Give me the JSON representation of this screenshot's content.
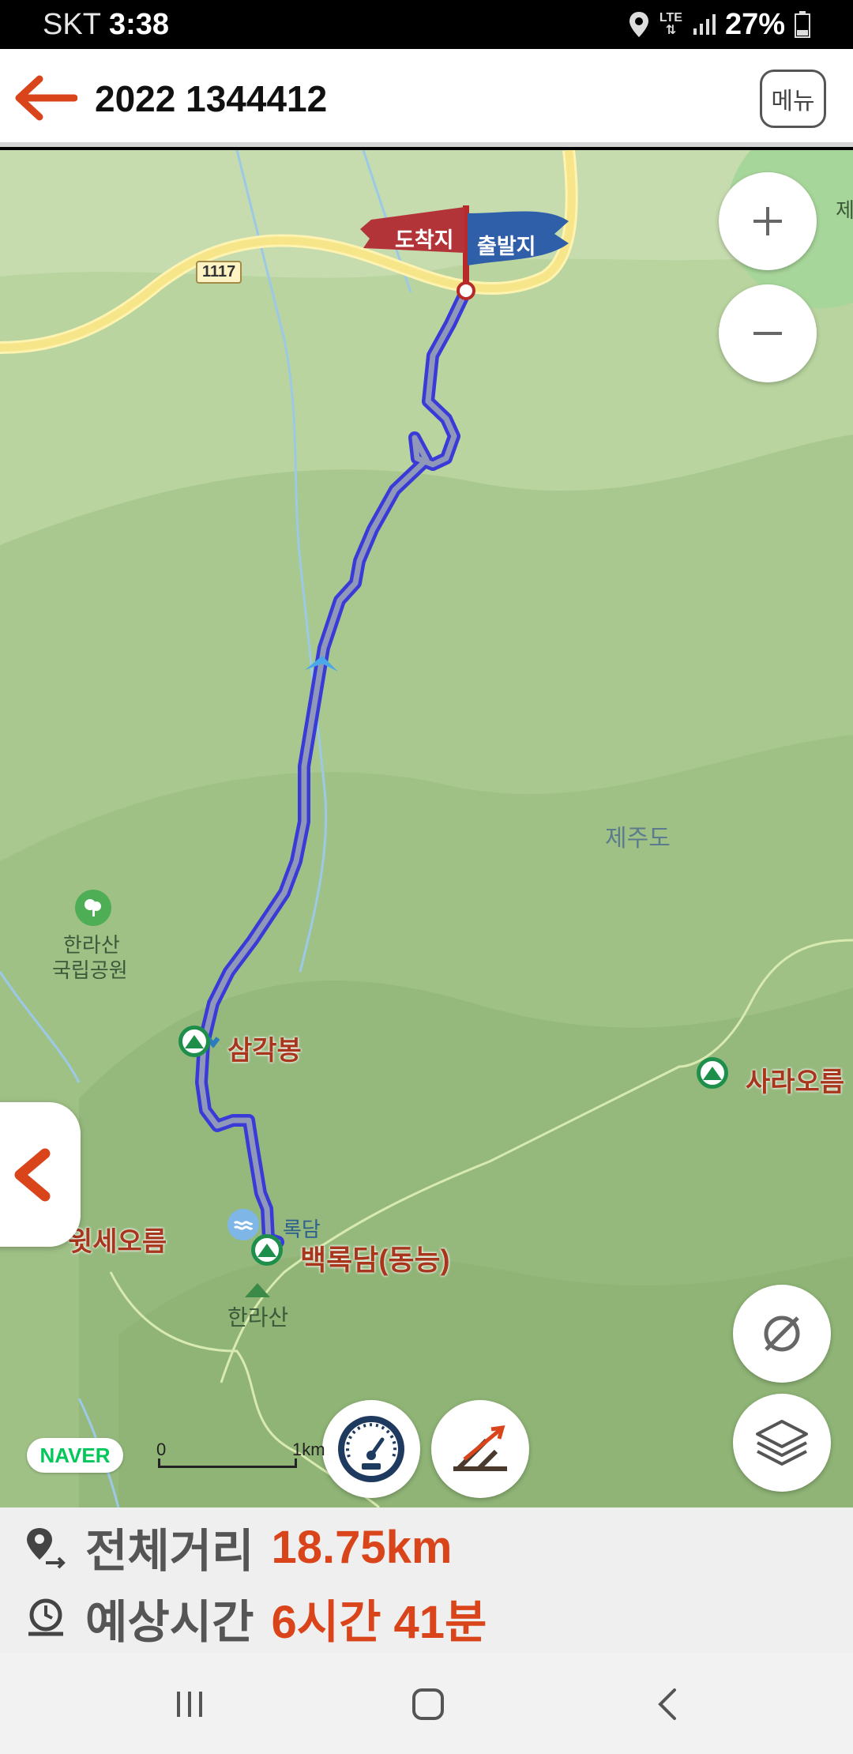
{
  "status": {
    "carrier": "SKT",
    "time": "3:38",
    "network": "LTE",
    "battery": "27%"
  },
  "header": {
    "title": "2022 1344412",
    "menu_label": "메뉴",
    "back_icon": "arrow-left-icon"
  },
  "map": {
    "flags": {
      "arrival": "도착지",
      "departure": "출발지"
    },
    "road_number": "1117",
    "places": {
      "hallasan_park_1": "한라산",
      "hallasan_park_2": "국립공원",
      "jejudo": "제주도",
      "samgakbong": "삼각봉",
      "saraoreum": "사라오름",
      "witseoreum": "윗세오름",
      "baengnokdam_east": "백록담(동능)",
      "baengnokdam_partial": "록담",
      "hallasan": "한라산",
      "edge_partial": "제"
    },
    "naver_logo": "NAVER",
    "scale": {
      "start": "0",
      "end": "1km"
    }
  },
  "info": {
    "distance_label": "전체거리",
    "distance_value": "18.75km",
    "time_label": "예상시간",
    "time_value": "6시간 41분"
  },
  "colors": {
    "accent": "#d9441b",
    "route": "#2f2fd6",
    "map_bg": "#b8d29e"
  }
}
